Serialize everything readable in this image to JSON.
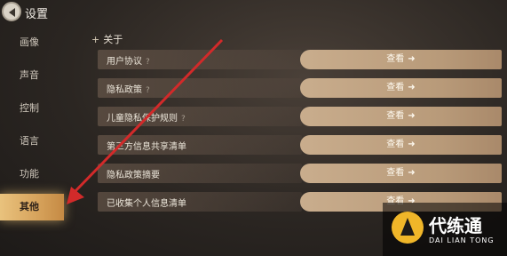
{
  "header": {
    "title": "设置"
  },
  "sidebar": {
    "items": [
      {
        "label": "画像"
      },
      {
        "label": "声音"
      },
      {
        "label": "控制"
      },
      {
        "label": "语言"
      },
      {
        "label": "功能"
      },
      {
        "label": "其他",
        "active": true
      }
    ]
  },
  "section": {
    "prefix": "+",
    "title": "关于"
  },
  "rows": [
    {
      "label": "用户协议",
      "help": "?",
      "button": "查看"
    },
    {
      "label": "隐私政策",
      "help": "?",
      "button": "查看"
    },
    {
      "label": "儿童隐私保护规则",
      "help": "?",
      "button": "查看"
    },
    {
      "label": "第三方信息共享清单",
      "help": "",
      "button": "查看"
    },
    {
      "label": "隐私政策摘要",
      "help": "",
      "button": "查看"
    },
    {
      "label": "已收集个人信息清单",
      "help": "",
      "button": "查看"
    }
  ],
  "button_arrow": "➜",
  "watermark": {
    "name": "代练通",
    "sub": "DAI LIAN TONG"
  },
  "colors": {
    "active_tab": "#e0b46c",
    "view_button": "#c2a583",
    "annotation_arrow": "#d22a2a"
  }
}
